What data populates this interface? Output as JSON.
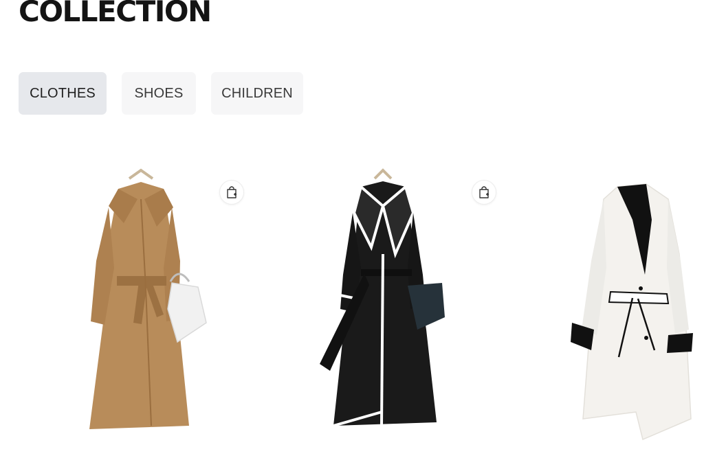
{
  "page": {
    "title": "COLLECTION"
  },
  "tabs": [
    {
      "label": "CLOTHES",
      "active": true
    },
    {
      "label": "SHOES",
      "active": false
    },
    {
      "label": "CHILDREN",
      "active": false
    }
  ],
  "products": [
    {
      "icon": "shopping-bag-add-icon",
      "coat_color": "#b88c5a"
    },
    {
      "icon": "shopping-bag-add-icon",
      "coat_color": "#1a1a1a"
    },
    {
      "icon": "shopping-bag-add-icon",
      "coat_color": "#f4f2ee"
    }
  ],
  "colors": {
    "title": "#141414",
    "tab_active_bg": "#e6e8ec",
    "tab_bg": "#f6f6f7"
  }
}
